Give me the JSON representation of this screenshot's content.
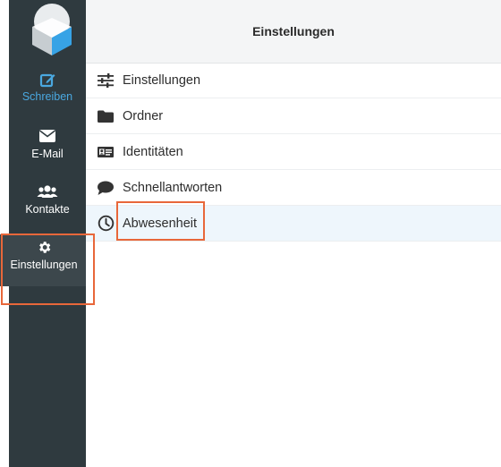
{
  "window": {
    "title": "Einstellungen"
  },
  "sidebar": {
    "items": [
      {
        "label": "Schreiben",
        "icon": "compose-icon",
        "color": "#4aa8e0"
      },
      {
        "label": "E-Mail",
        "icon": "mail-icon"
      },
      {
        "label": "Kontakte",
        "icon": "contacts-icon"
      },
      {
        "label": "Einstellungen",
        "icon": "gear-icon",
        "active": true
      }
    ]
  },
  "settings": {
    "items": [
      {
        "label": "Einstellungen",
        "icon": "sliders-icon"
      },
      {
        "label": "Ordner",
        "icon": "folder-icon"
      },
      {
        "label": "Identitäten",
        "icon": "id-card-icon"
      },
      {
        "label": "Schnellantworten",
        "icon": "comment-icon"
      },
      {
        "label": "Abwesenheit",
        "icon": "clock-icon",
        "selected": true
      }
    ]
  },
  "colors": {
    "sidebar_bg": "#2f3a3f",
    "accent": "#4aa8e0",
    "highlight_box": "#e8673a",
    "selected_row_bg": "#eef6fc"
  }
}
